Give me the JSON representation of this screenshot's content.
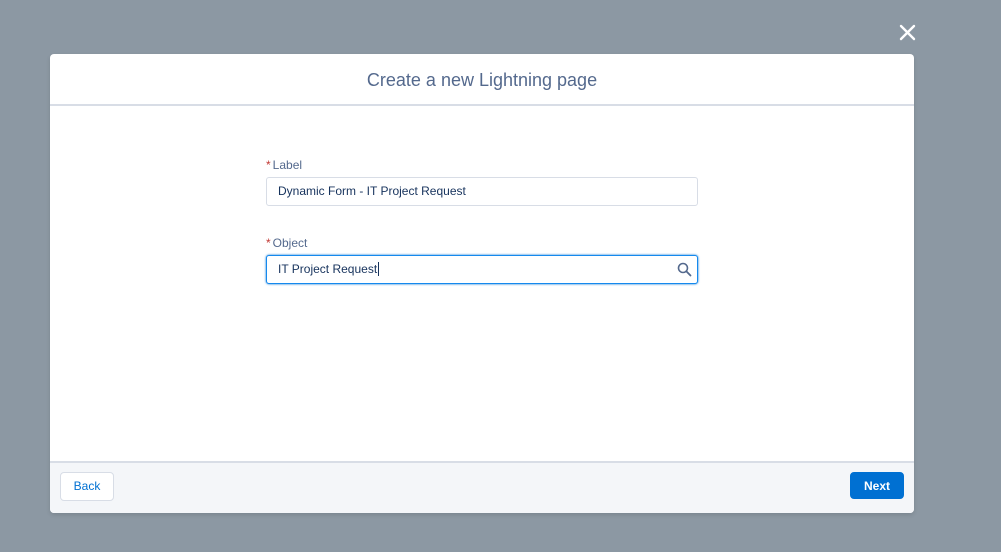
{
  "overlay": {
    "close_icon": "close-icon"
  },
  "modal": {
    "title": "Create a new Lightning page",
    "fields": {
      "label": {
        "required_marker": "*",
        "label": "Label",
        "value": "Dynamic Form - IT Project Request"
      },
      "object": {
        "required_marker": "*",
        "label": "Object",
        "value": "IT Project Request",
        "icon": "search-icon"
      }
    },
    "footer": {
      "back_label": "Back",
      "next_label": "Next"
    }
  },
  "colors": {
    "backdrop": "#8c98a3",
    "brand": "#0070d2",
    "title_text": "#54698d",
    "required": "#c23934",
    "focus_border": "#1589ee"
  }
}
